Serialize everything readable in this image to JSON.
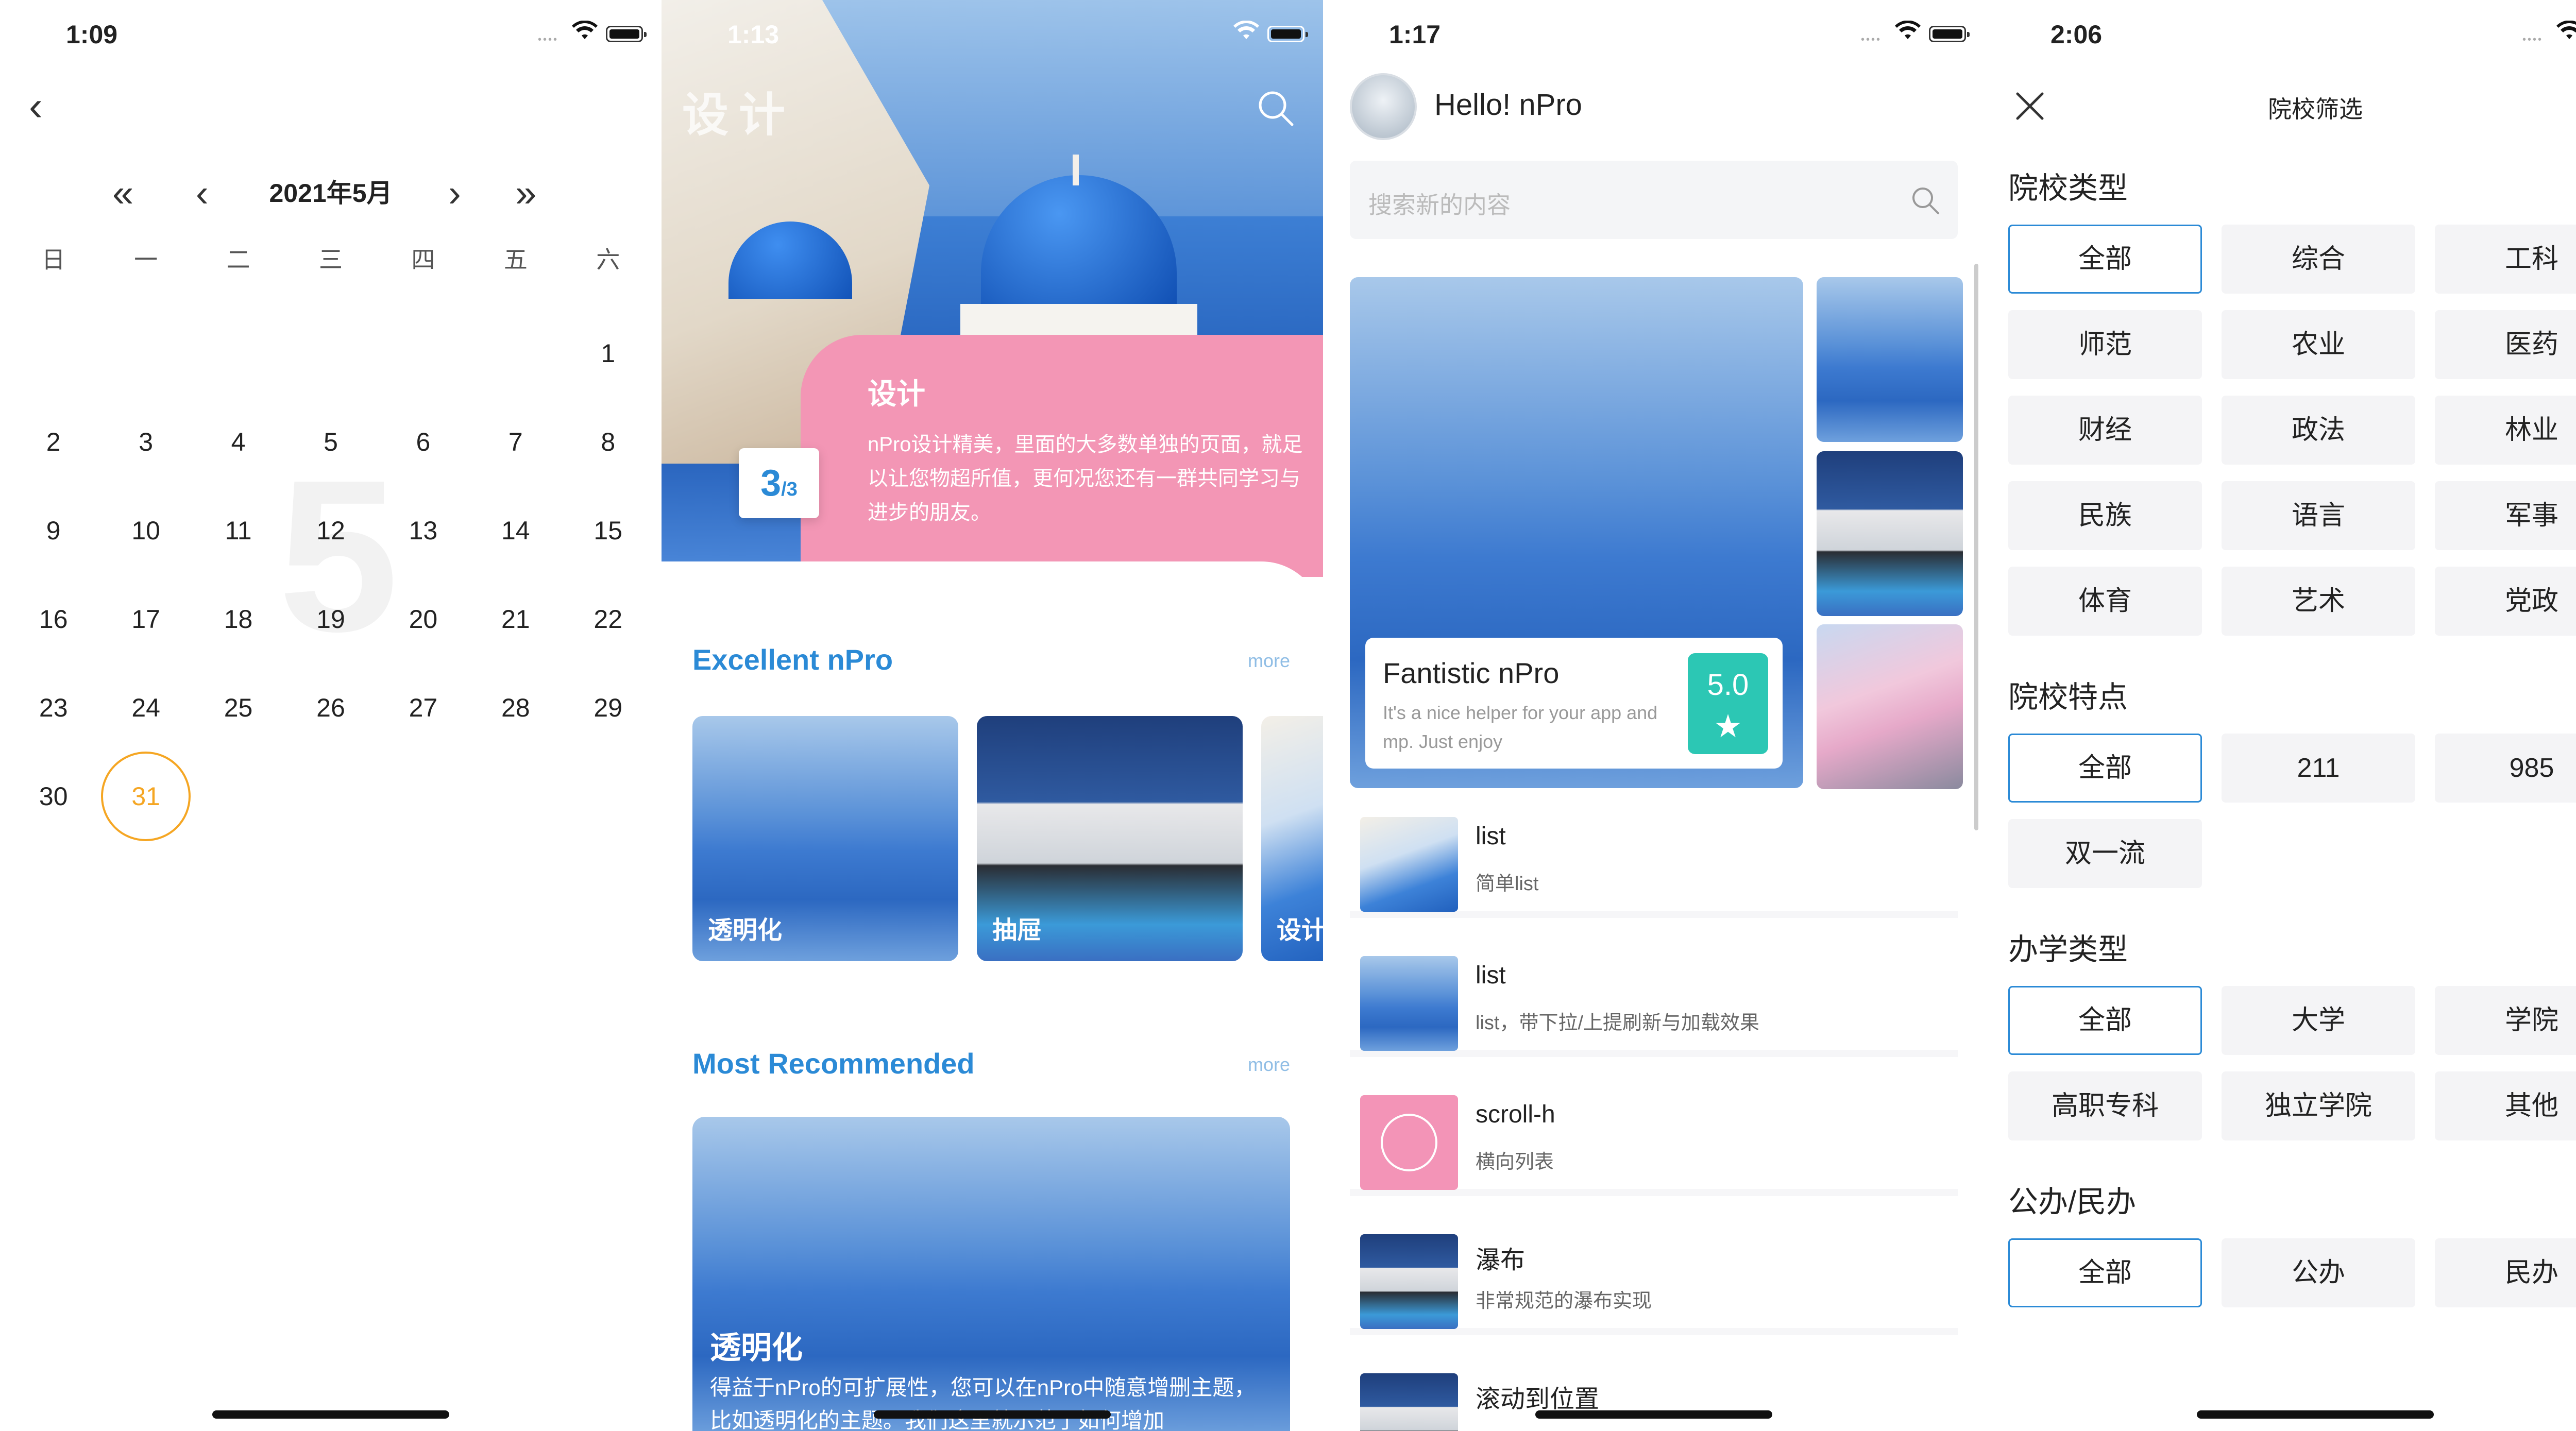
{
  "calendar": {
    "time": "1:09",
    "month_label": "2021年5月",
    "nav": {
      "prev_year": "«",
      "prev_month": "‹",
      "next_month": "›",
      "next_year": "»",
      "back": "‹"
    },
    "weekdays": [
      "日",
      "一",
      "二",
      "三",
      "四",
      "五",
      "六"
    ],
    "bg_month": "5",
    "weeks": [
      [
        "",
        "",
        "",
        "",
        "",
        "",
        "1"
      ],
      [
        "2",
        "3",
        "4",
        "5",
        "6",
        "7",
        "8"
      ],
      [
        "9",
        "10",
        "11",
        "12",
        "13",
        "14",
        "15"
      ],
      [
        "16",
        "17",
        "18",
        "19",
        "20",
        "21",
        "22"
      ],
      [
        "23",
        "24",
        "25",
        "26",
        "27",
        "28",
        "29"
      ],
      [
        "30",
        "31",
        "",
        "",
        "",
        "",
        ""
      ]
    ],
    "today": "31",
    "today_color": "#f5a623"
  },
  "design": {
    "time": "1:13",
    "hero_title": "设计",
    "card_title": "设计",
    "card_desc": "nPro设计精美，里面的大多数单独的页面，就足以让您物超所值，更何况您还有一群共同学习与进步的朋友。",
    "counter_current": "3",
    "counter_total": "/3",
    "section1_title": "Excellent nPro",
    "section1_more": "more",
    "tiles": [
      "透明化",
      "抽屉",
      "设计"
    ],
    "section2_title": "Most Recommended",
    "section2_more": "more",
    "rec_title": "透明化",
    "rec_desc": "得益于nPro的可扩展性，您可以在nPro中随意增删主题，比如透明化的主题。我们这里就示范了如何增加",
    "accent": "#2b8ad6",
    "card_color": "#f396b5"
  },
  "home": {
    "time": "1:17",
    "greeting": "Hello! nPro",
    "search_placeholder": "搜索新的内容",
    "feature_title": "Fantistic nPro",
    "feature_desc": "It's a nice helper for your app and mp. Just enjoy",
    "score": "5.0",
    "badge_color": "#2cc7b4",
    "list": [
      {
        "title": "list",
        "desc": "简单list"
      },
      {
        "title": "list",
        "desc": "list，带下拉/上提刷新与加载效果"
      },
      {
        "title": "scroll-h",
        "desc": "横向列表"
      },
      {
        "title": "瀑布",
        "desc": "非常规范的瀑布实现"
      },
      {
        "title": "滚动到位置",
        "desc": ""
      }
    ]
  },
  "filter": {
    "time": "2:06",
    "title": "院校筛选",
    "groups": [
      {
        "title": "院校类型",
        "options": [
          "全部",
          "综合",
          "工科",
          "师范",
          "农业",
          "医药",
          "财经",
          "政法",
          "林业",
          "民族",
          "语言",
          "军事",
          "体育",
          "艺术",
          "党政"
        ]
      },
      {
        "title": "院校特点",
        "options": [
          "全部",
          "211",
          "985",
          "双一流"
        ]
      },
      {
        "title": "办学类型",
        "options": [
          "全部",
          "大学",
          "学院",
          "高职专科",
          "独立学院",
          "其他"
        ]
      },
      {
        "title": "公办/民办",
        "options": [
          "全部",
          "公办",
          "民办"
        ]
      }
    ],
    "active_color": "#2b8ad6"
  }
}
